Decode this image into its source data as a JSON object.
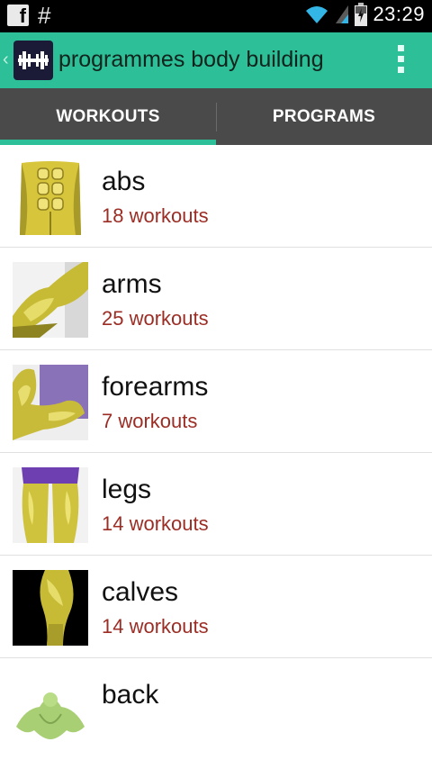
{
  "status_bar": {
    "left_icons": [
      "facebook-icon",
      "hash-icon"
    ],
    "facebook_glyph": "f",
    "hash_glyph": "#",
    "right_icons": [
      "wifi-icon",
      "signal-icon",
      "battery-icon"
    ],
    "time": "23:29"
  },
  "action_bar": {
    "title": "programmes body building",
    "icon": "dumbbell-icon",
    "overflow_icon": "overflow-menu-icon",
    "color": "#2dbf97"
  },
  "tabs": [
    {
      "label": "WORKOUTS",
      "active": true
    },
    {
      "label": "PROGRAMS",
      "active": false
    }
  ],
  "muscle_groups": [
    {
      "name": "abs",
      "count": "18 workouts",
      "icon": "abs-muscle-image"
    },
    {
      "name": "arms",
      "count": "25 workouts",
      "icon": "arms-muscle-image"
    },
    {
      "name": "forearms",
      "count": "7 workouts",
      "icon": "forearms-muscle-image"
    },
    {
      "name": "legs",
      "count": "14 workouts",
      "icon": "legs-muscle-image"
    },
    {
      "name": "calves",
      "count": "14 workouts",
      "icon": "calves-muscle-image"
    },
    {
      "name": "back",
      "count": "",
      "icon": "back-muscle-image"
    }
  ],
  "colors": {
    "accent": "#2dbf97",
    "tab_bar": "#4a4a4a",
    "count_text": "#9b2d25"
  }
}
